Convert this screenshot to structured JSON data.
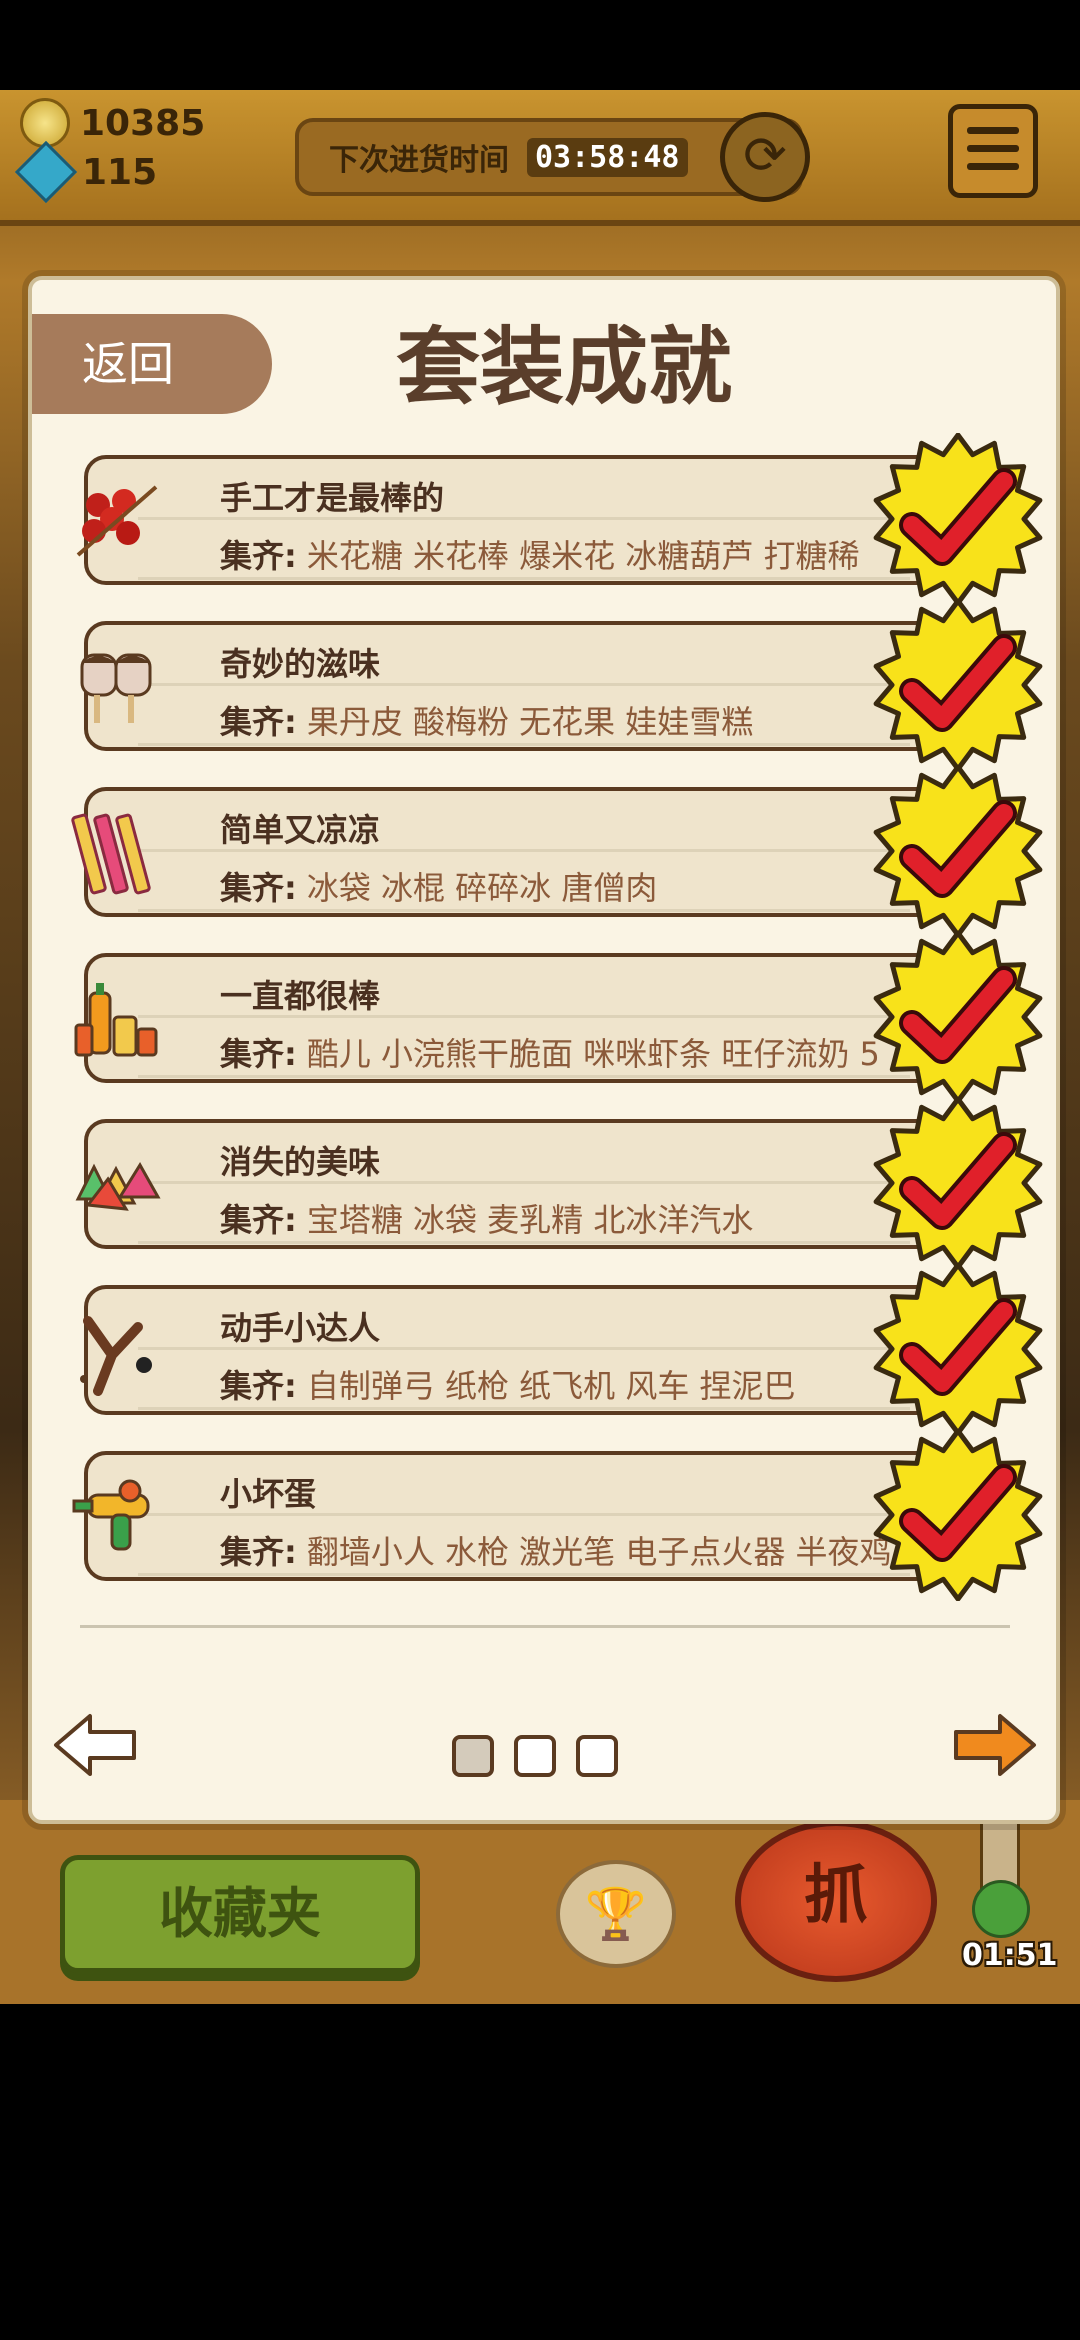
{
  "hud": {
    "coins": "10385",
    "gems": "115",
    "restock_label": "下次进货时间",
    "restock_timer": "03:58:48"
  },
  "bottom": {
    "favorites_label": "收藏夹",
    "grab_label": "抓",
    "countdown": "01:51"
  },
  "modal": {
    "back_label": "返回",
    "title": "套装成就",
    "collect_label": "集齐:",
    "sets": [
      {
        "name": "手工才是最棒的",
        "items": "米花糖 米花棒 爆米花 冰糖葫芦 打糖稀",
        "completed": true,
        "icon": "candied-haws-icon"
      },
      {
        "name": "奇妙的滋味",
        "items": "果丹皮 酸梅粉 无花果 娃娃雪糕",
        "completed": true,
        "icon": "doll-ice-cream-icon"
      },
      {
        "name": "简单又凉凉",
        "items": "冰袋 冰棍 碎碎冰 唐僧肉",
        "completed": true,
        "icon": "ice-sticks-icon"
      },
      {
        "name": "一直都很棒",
        "items": "酷儿 小浣熊干脆面 咪咪虾条 旺仔流奶 5",
        "completed": true,
        "icon": "drinks-icon"
      },
      {
        "name": "消失的美味",
        "items": "宝塔糖 冰袋 麦乳精 北冰洋汽水",
        "completed": true,
        "icon": "pagoda-candy-icon"
      },
      {
        "name": "动手小达人",
        "items": "自制弹弓 纸枪 纸飞机 风车 捏泥巴",
        "completed": true,
        "icon": "slingshot-icon"
      },
      {
        "name": "小坏蛋",
        "items": "翻墙小人 水枪 激光笔 电子点火器 半夜鸡",
        "completed": true,
        "icon": "water-gun-icon"
      }
    ],
    "pagination": {
      "current": 1,
      "total": 3
    },
    "colors": {
      "badge_yellow": "#f8e21a",
      "check_red": "#e0202a",
      "next_arrow": "#f08a1e"
    }
  }
}
